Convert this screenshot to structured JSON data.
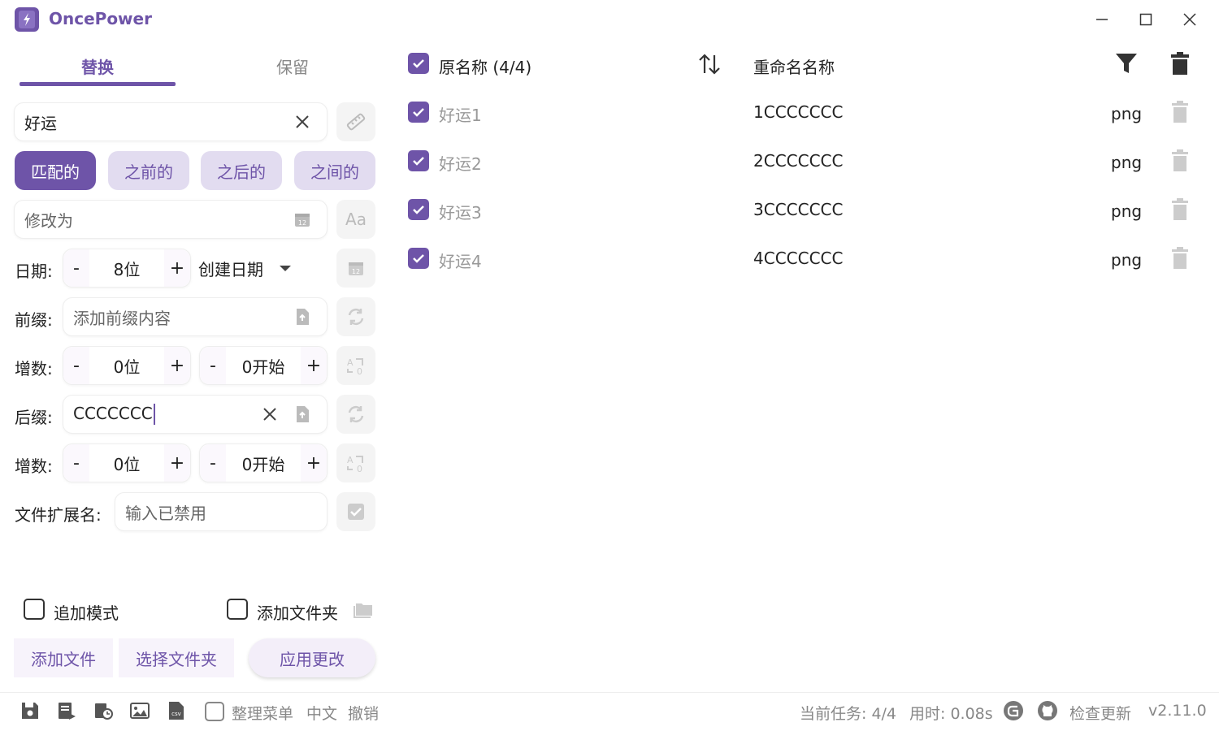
{
  "app": {
    "title": "OncePower"
  },
  "colors": {
    "accent": "#6e54a8",
    "accent_light": "#e2dcf0",
    "muted": "#999999"
  },
  "tabs": [
    {
      "label": "替换",
      "active": true
    },
    {
      "label": "保留",
      "active": false
    }
  ],
  "find": {
    "value": "好运"
  },
  "modes": [
    "匹配的",
    "之前的",
    "之后的",
    "之间的"
  ],
  "replace": {
    "placeholder": "修改为"
  },
  "date": {
    "label": "日期:",
    "digits": "8位",
    "type": "创建日期"
  },
  "prefix": {
    "label": "前缀:",
    "placeholder": "添加前缀内容"
  },
  "prefix_inc": {
    "label": "增数:",
    "digits": "0位",
    "start": "0开始"
  },
  "suffix": {
    "label": "后缀:",
    "value": "CCCCCCC"
  },
  "suffix_inc": {
    "label": "增数:",
    "digits": "0位",
    "start": "0开始"
  },
  "extension": {
    "label": "文件扩展名:",
    "placeholder": "输入已禁用"
  },
  "options": {
    "append_mode": "追加模式",
    "add_folder": "添加文件夹"
  },
  "actions": {
    "add_files": "添加文件",
    "select_folder": "选择文件夹",
    "apply": "应用更改"
  },
  "list": {
    "header_original": "原名称 (4/4)",
    "header_renamed": "重命名名称",
    "rows": [
      {
        "original": "好运1",
        "renamed": "1CCCCCCC",
        "ext": "png"
      },
      {
        "original": "好运2",
        "renamed": "2CCCCCCC",
        "ext": "png"
      },
      {
        "original": "好运3",
        "renamed": "3CCCCCCC",
        "ext": "png"
      },
      {
        "original": "好运4",
        "renamed": "4CCCCCCC",
        "ext": "png"
      }
    ]
  },
  "footer": {
    "organize_menu": "整理菜单",
    "language": "中文",
    "undo": "撤销",
    "task": "当前任务: 4/4",
    "time": "用时: 0.08s",
    "check_update": "检查更新",
    "version": "v2.11.0"
  }
}
